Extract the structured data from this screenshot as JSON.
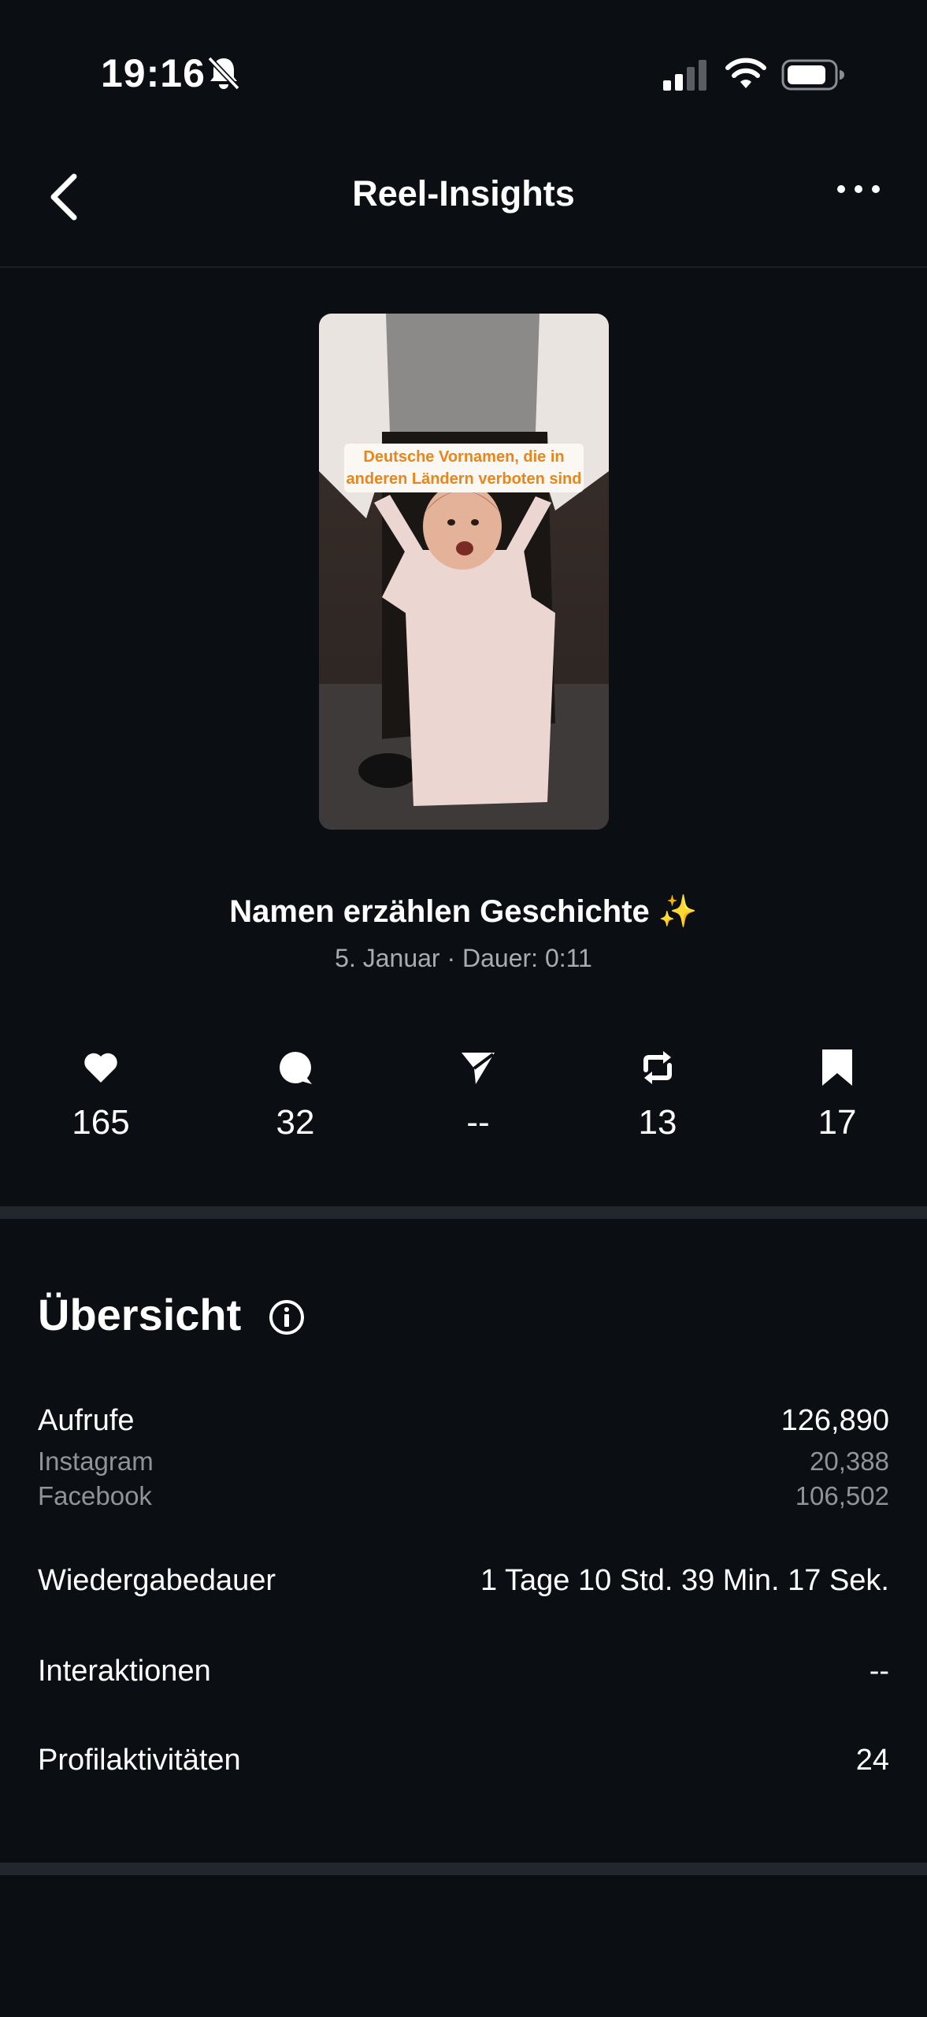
{
  "status_bar": {
    "time": "19:16"
  },
  "header": {
    "title": "Reel-Insights"
  },
  "reel": {
    "overlay_line1": "Deutsche Vornamen, die in",
    "overlay_line2": "anderen Ländern verboten sind",
    "title": "Namen erzählen Geschichte ✨",
    "meta": "5. Januar · Dauer: 0:11"
  },
  "stats": {
    "likes": "165",
    "comments": "32",
    "shares": "--",
    "reposts": "13",
    "saves": "17"
  },
  "overview": {
    "title": "Übersicht",
    "views_label": "Aufrufe",
    "views_value": "126,890",
    "instagram_label": "Instagram",
    "instagram_value": "20,388",
    "facebook_label": "Facebook",
    "facebook_value": "106,502",
    "watch_time_label": "Wiedergabedauer",
    "watch_time_value": "1 Tage 10 Std. 39 Min. 17 Sek.",
    "interactions_label": "Interaktionen",
    "interactions_value": "--",
    "profile_activity_label": "Profilaktivitäten",
    "profile_activity_value": "24"
  },
  "colors": {
    "background": "#0b0f14",
    "divider": "#22272d",
    "secondary_text": "#a8adb3",
    "overlay_text": "#e8861e"
  }
}
